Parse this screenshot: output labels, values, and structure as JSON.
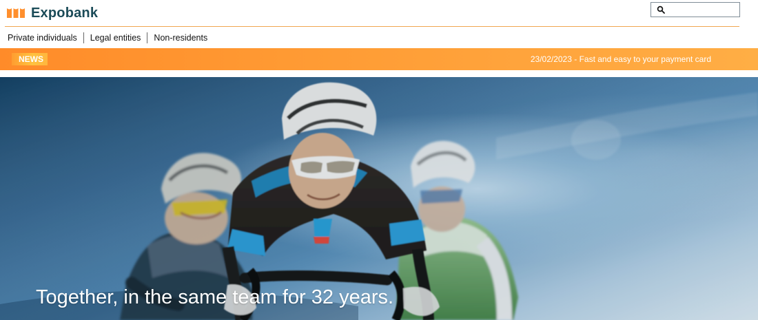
{
  "header": {
    "brand_name": "Expobank",
    "logo_icon": "expobank-logo-icon",
    "search": {
      "icon": "search-icon",
      "value": "",
      "placeholder": ""
    }
  },
  "navigation": {
    "items": [
      {
        "label": "Private individuals"
      },
      {
        "label": "Legal entities"
      },
      {
        "label": "Non-residents"
      }
    ]
  },
  "news": {
    "badge": "NEWS",
    "text": "23/02/2023 - Fast and easy to your payment card"
  },
  "hero": {
    "title": "Together, in the same team for 32 years."
  },
  "colors": {
    "brand_orange": "#ff9a33",
    "brand_navy": "#1b4b58",
    "hero_sky_blue": "#5b91bc"
  }
}
